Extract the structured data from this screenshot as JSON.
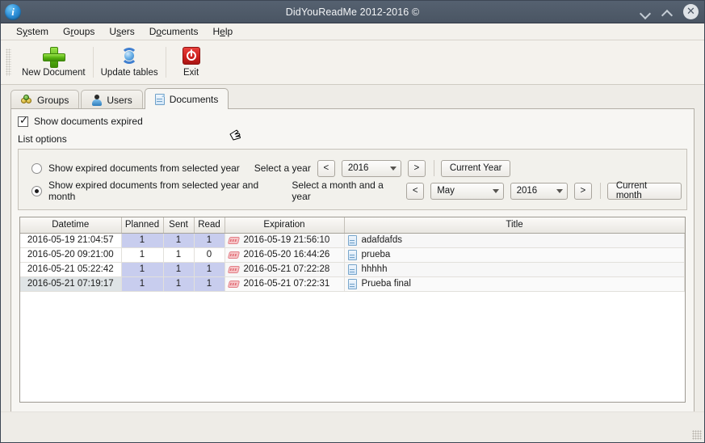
{
  "window": {
    "title": "DidYouReadMe 2012-2016 ©",
    "app_icon": "info-icon",
    "minimize": "▾",
    "maximize": "▴",
    "close": "✕"
  },
  "menubar": {
    "items": [
      {
        "label": "System",
        "pre": "S",
        "mn": "y",
        "post": "stem"
      },
      {
        "label": "Groups",
        "pre": "G",
        "mn": "r",
        "post": "oups"
      },
      {
        "label": "Users",
        "pre": "U",
        "mn": "s",
        "post": "ers"
      },
      {
        "label": "Documents",
        "pre": "D",
        "mn": "o",
        "post": "cuments"
      },
      {
        "label": "Help",
        "pre": "H",
        "mn": "e",
        "post": "lp"
      }
    ]
  },
  "toolbar": {
    "new_document": "New Document",
    "update_tables": "Update tables",
    "exit": "Exit"
  },
  "tabs": [
    {
      "label": "Groups",
      "icon": "groups-icon",
      "active": false
    },
    {
      "label": "Users",
      "icon": "user-icon",
      "active": false
    },
    {
      "label": "Documents",
      "icon": "document-icon",
      "active": true
    }
  ],
  "options": {
    "show_expired_checkbox": {
      "label": "Show documents expired",
      "checked": true
    },
    "list_options_label": "List options",
    "year_row": {
      "radio_label": "Show expired documents from selected year",
      "selected": false,
      "field_label": "Select a year",
      "prev_button": "<",
      "next_button": ">",
      "year_value": "2016",
      "action_button": "Current Year"
    },
    "month_row": {
      "radio_label": "Show expired documents from selected year and month",
      "selected": true,
      "field_label": "Select a month and a year",
      "prev_button": "<",
      "next_button": ">",
      "month_value": "May",
      "year_value": "2016",
      "action_button": "Current month"
    }
  },
  "table": {
    "columns": [
      "Datetime",
      "Planned",
      "Sent",
      "Read",
      "Expiration",
      "Title"
    ],
    "rows": [
      {
        "datetime": "2016-05-19 21:04:57",
        "planned": "1",
        "sent": "1",
        "read": "1",
        "expiration": "2016-05-19 21:56:10",
        "title": "adafdafds",
        "highlight": true,
        "selected": false
      },
      {
        "datetime": "2016-05-20 09:21:00",
        "planned": "1",
        "sent": "1",
        "read": "0",
        "expiration": "2016-05-20 16:44:26",
        "title": "prueba",
        "highlight": false,
        "selected": false
      },
      {
        "datetime": "2016-05-21 05:22:42",
        "planned": "1",
        "sent": "1",
        "read": "1",
        "expiration": "2016-05-21 07:22:28",
        "title": "hhhhh",
        "highlight": true,
        "selected": false
      },
      {
        "datetime": "2016-05-21 07:19:17",
        "planned": "1",
        "sent": "1",
        "read": "1",
        "expiration": "2016-05-21 07:22:31",
        "title": "Prueba final",
        "highlight": true,
        "selected": true
      }
    ]
  },
  "colors": {
    "titlebar": "#4a5563",
    "window_bg": "#eeece7",
    "row_highlight": "#c8cdee",
    "accent_green": "#57b310",
    "accent_red": "#cc1f1b",
    "accent_blue": "#2f78c4"
  }
}
